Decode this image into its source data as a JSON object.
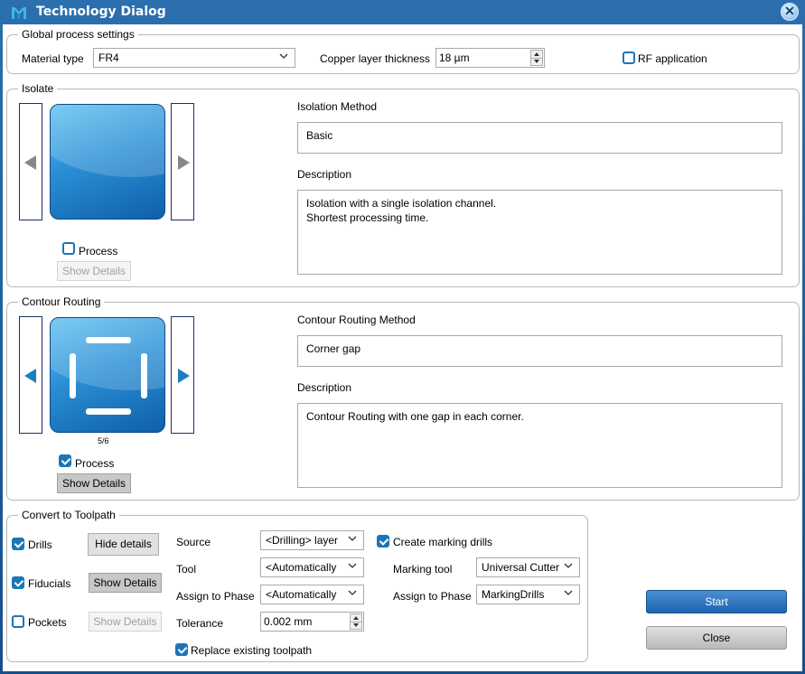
{
  "window": {
    "title": "Technology Dialog",
    "close_symbol": "✕"
  },
  "global": {
    "group_title": "Global process settings",
    "material_label": "Material type",
    "material_value": "FR4",
    "copper_label": "Copper layer thickness",
    "copper_value": "18 µm",
    "rf_label": "RF application",
    "rf_checked": false
  },
  "isolate": {
    "group_title": "Isolate",
    "process_label": "Process",
    "process_checked": false,
    "details_label": "Show Details",
    "method_label": "Isolation Method",
    "method_value": "Basic",
    "desc_label": "Description",
    "desc_value": "Isolation with a single isolation channel.\nShortest processing time."
  },
  "contour": {
    "group_title": "Contour Routing",
    "counter": "5/6",
    "process_label": "Process",
    "process_checked": true,
    "details_label": "Show Details",
    "method_label": "Contour Routing Method",
    "method_value": "Corner gap",
    "desc_label": "Description",
    "desc_value": "Contour Routing with one gap in each corner."
  },
  "toolpath": {
    "group_title": "Convert to Toolpath",
    "drills_label": "Drills",
    "drills_checked": true,
    "drills_btn": "Hide details",
    "fiducials_label": "Fiducials",
    "fiducials_checked": true,
    "fiducials_btn": "Show Details",
    "pockets_label": "Pockets",
    "pockets_checked": false,
    "pockets_btn": "Show Details",
    "source_label": "Source",
    "source_value": "<Drilling> layer",
    "tool_label": "Tool",
    "tool_value": "<Automatically",
    "phase_label": "Assign to Phase",
    "phase_value": "<Automatically",
    "tolerance_label": "Tolerance",
    "tolerance_value": "0.002 mm",
    "replace_label": "Replace existing toolpath",
    "replace_checked": true,
    "marking_label": "Create marking drills",
    "marking_checked": true,
    "marking_tool_label": "Marking tool",
    "marking_tool_value": "Universal Cutter",
    "marking_phase_label": "Assign to Phase",
    "marking_phase_value": "MarkingDrills"
  },
  "actions": {
    "start_label": "Start",
    "close_label": "Close"
  },
  "colors": {
    "accent": "#1b75b8",
    "title_bar": "#1a5a98"
  }
}
